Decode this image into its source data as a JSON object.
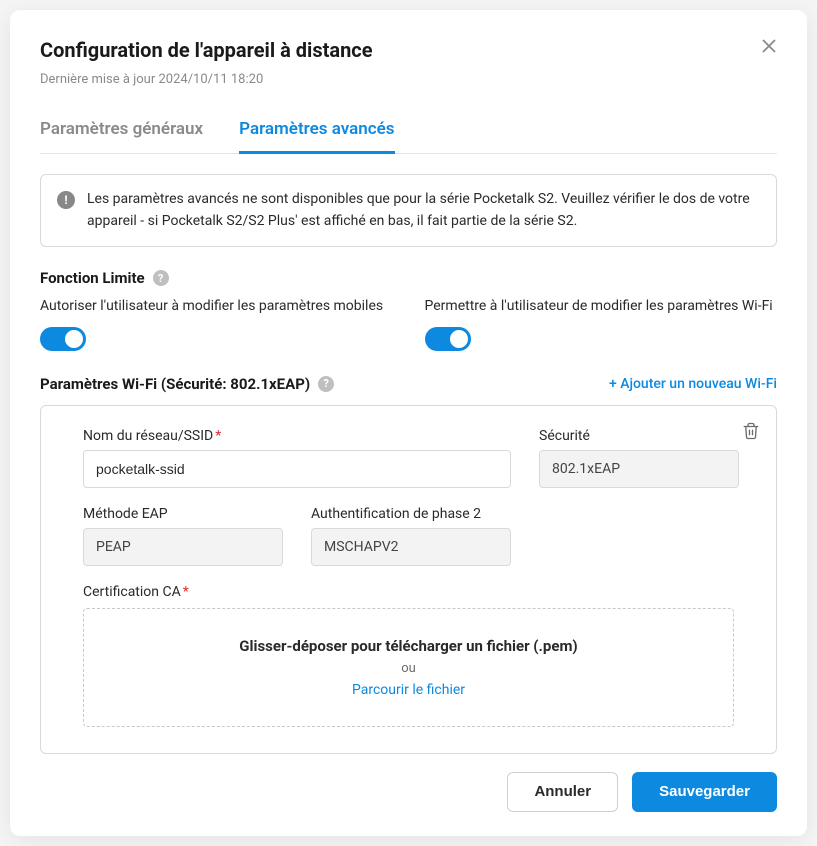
{
  "header": {
    "title": "Configuration de l'appareil à distance",
    "last_updated": "Dernière mise à jour 2024/10/11 18:20"
  },
  "tabs": {
    "general": "Paramètres généraux",
    "advanced": "Paramètres avancés"
  },
  "notice": {
    "text": "Les paramètres avancés ne sont disponibles que pour la série Pocketalk S2. Veuillez vérifier le dos de votre appareil - si Pocketalk S2/S2 Plus' est affiché en bas, il fait partie de la série S2."
  },
  "limit_function": {
    "heading": "Fonction Limite",
    "toggles": [
      {
        "label": "Autoriser l'utilisateur à modifier les paramètres mobiles",
        "on": true
      },
      {
        "label": "Permettre à l'utilisateur de modifier les paramètres Wi-Fi",
        "on": true
      }
    ]
  },
  "wifi": {
    "heading": "Paramètres Wi-Fi (Sécurité: 802.1xEAP)",
    "add_label": "+ Ajouter un nouveau Wi-Fi",
    "fields": {
      "ssid_label": "Nom du réseau/SSID",
      "ssid_value": "pocketalk-ssid",
      "security_label": "Sécurité",
      "security_value": "802.1xEAP",
      "eap_label": "Méthode EAP",
      "eap_value": "PEAP",
      "phase2_label": "Authentification de phase 2",
      "phase2_value": "MSCHAPV2",
      "cert_label": "Certification CA",
      "dropzone_main": "Glisser-déposer pour télécharger un fichier (.pem)",
      "dropzone_or": "ou",
      "dropzone_link": "Parcourir le fichier"
    }
  },
  "footer": {
    "cancel": "Annuler",
    "save": "Sauvegarder"
  }
}
